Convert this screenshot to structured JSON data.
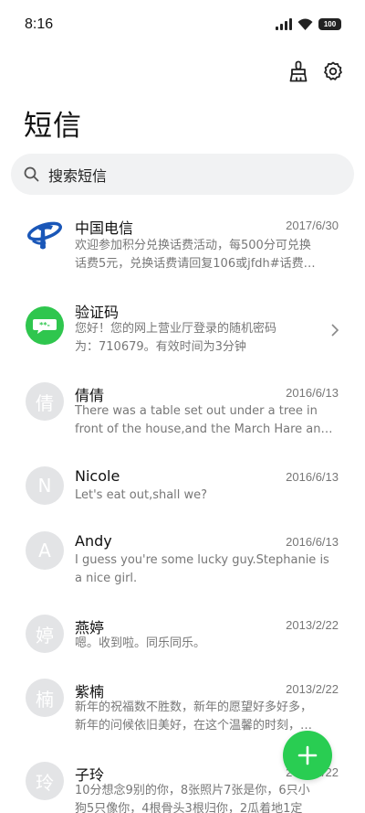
{
  "status": {
    "time": "8:16",
    "battery": "100"
  },
  "header": {
    "title": "短信",
    "icons": [
      "clean-brush-icon",
      "settings-gear-icon"
    ]
  },
  "search": {
    "placeholder": "搜索短信"
  },
  "accent_color": "#29cd52",
  "conversations": [
    {
      "name": "中国电信",
      "date": "2017/6/30",
      "line1": "欢迎参加积分兑换话费活动，每500分可兑换",
      "line2": "话费5元，兑换话费请回复106或jfdh#话费…",
      "avatar": "telecom-logo"
    },
    {
      "name": "验证码",
      "date": "",
      "line1": "您好！您的网上营业厅登录的随机密码",
      "line2": "为：710679。有效时间为3分钟",
      "avatar": "verification-code-icon"
    },
    {
      "name": "倩倩",
      "date": "2016/6/13",
      "line1": "There was a table set out under a tree in",
      "line2": "front of the house,and the March Hare an…",
      "initial": "倩"
    },
    {
      "name": "Nicole",
      "date": "2016/6/13",
      "line1": "Let's eat out,shall we?",
      "line2": "",
      "initial": "N"
    },
    {
      "name": "Andy",
      "date": "2016/6/13",
      "line1": "I guess you're some lucky guy.Stephanie is",
      "line2": "a nice girl.",
      "initial": "A"
    },
    {
      "name": "燕婷",
      "date": "2013/2/22",
      "line1": "嗯。收到啦。同乐同乐。",
      "line2": "",
      "initial": "婷"
    },
    {
      "name": "紫楠",
      "date": "2013/2/22",
      "line1": "新年的祝福数不胜数，新年的愿望好多好多，",
      "line2": "新年的问候依旧美好，在这个温馨的时刻，…",
      "initial": "楠"
    },
    {
      "name": "子玲",
      "date": "2013/2/22",
      "line1": "10分想念9别的你，8张照片7张是你，6只小",
      "line2": "狗5只像你，4根骨头3根归你，2瓜着地1定",
      "initial": "玲"
    }
  ],
  "fab": {
    "icon": "plus-icon"
  }
}
